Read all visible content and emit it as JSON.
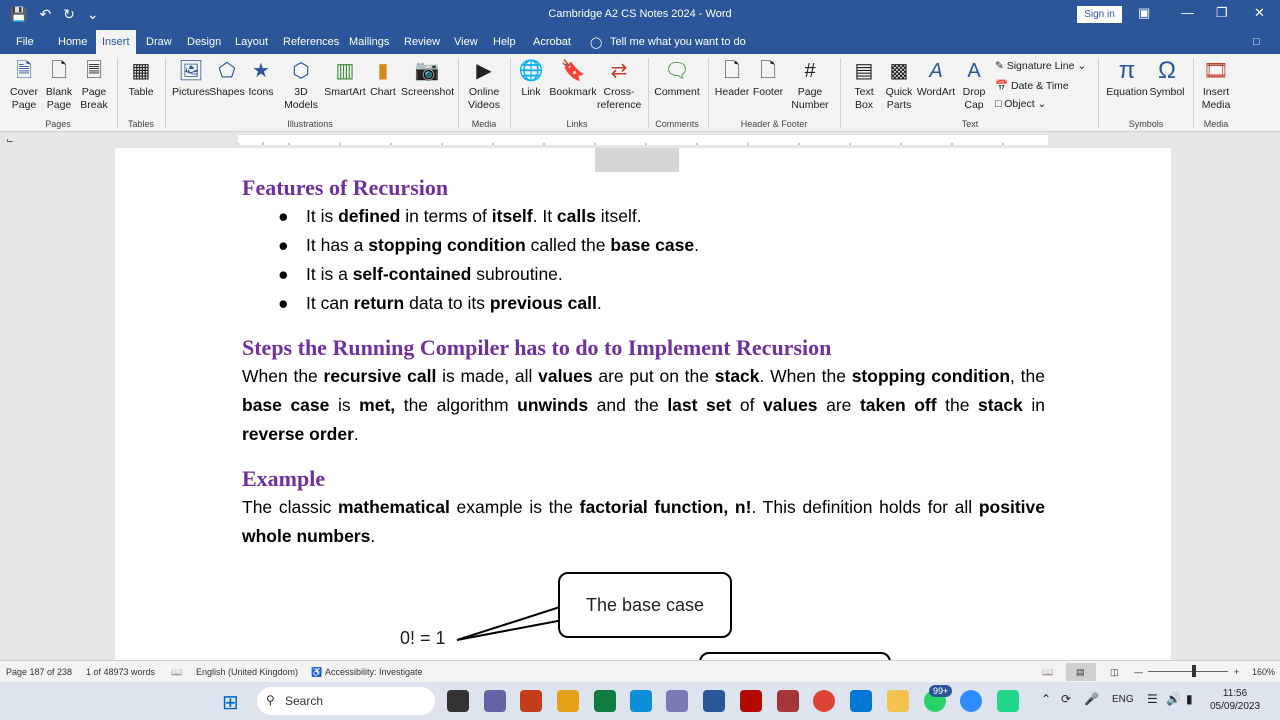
{
  "window": {
    "title": "Cambridge A2 CS Notes 2024  -  Word",
    "sign_in": "Sign in"
  },
  "tabs": [
    "File",
    "Home",
    "Insert",
    "Draw",
    "Design",
    "Layout",
    "References",
    "Mailings",
    "Review",
    "View",
    "Help",
    "Acrobat",
    "Tell me what you want to do"
  ],
  "ribbon": {
    "cover_page": "Cover Page",
    "blank_page": "Blank Page",
    "page_break": "Page Break",
    "group_pages": "Pages",
    "table": "Table",
    "group_tables": "Tables",
    "pictures": "Pictures",
    "shapes": "Shapes",
    "icons": "Icons",
    "models": "3D Models",
    "smartart": "SmartArt",
    "chart": "Chart",
    "screenshot": "Screenshot",
    "group_illustrations": "Illustrations",
    "online_videos": "Online Videos",
    "group_media": "Media",
    "link": "Link",
    "bookmark": "Bookmark",
    "crossref": "Cross-reference",
    "group_links": "Links",
    "comment": "Comment",
    "group_comments": "Comments",
    "header": "Header",
    "footer": "Footer",
    "page_number": "Page Number",
    "group_hf": "Header & Footer",
    "text_box": "Text Box",
    "quick_parts": "Quick Parts",
    "wordart": "WordArt",
    "drop_cap": "Drop Cap",
    "signature_line": "Signature Line",
    "date_time": "Date & Time",
    "object": "Object",
    "group_text": "Text",
    "equation": "Equation",
    "symbol": "Symbol",
    "group_symbols": "Symbols",
    "insert_media": "Insert Media",
    "group_media2": "Media"
  },
  "doc": {
    "features_heading": "Features of Recursion",
    "bullets": [
      {
        "a": "It is ",
        "b": "defined",
        "c": " in terms of ",
        "d": "itself",
        "e": ". It ",
        "f": "calls",
        "g": " itself."
      },
      {
        "a": "It has a ",
        "b": "stopping condition",
        "c": " called the ",
        "d": "base case",
        "e": ".",
        "f": "",
        "g": ""
      },
      {
        "a": "It is a ",
        "b": "self-contained",
        "c": " subroutine.",
        "d": "",
        "e": "",
        "f": "",
        "g": ""
      },
      {
        "a": "It can ",
        "b": "return",
        "c": " data to its ",
        "d": "previous call",
        "e": ".",
        "f": "",
        "g": ""
      }
    ],
    "steps_heading": "Steps the Running Compiler has to do to Implement Recursion",
    "steps": {
      "t1": "When the ",
      "b1": "recursive call",
      "t2": " is made, all ",
      "b2": "values",
      "t3": " are put on the ",
      "b3": "stack",
      "t4": ". When the ",
      "b4": "stopping condition",
      "t5": ", the ",
      "b5": "base case",
      "t6": " is ",
      "b6": "met,",
      "t7": " the algorithm ",
      "b7": "unwinds",
      "t8": " and the ",
      "b8": "last set",
      "t9": " of ",
      "b9": "values",
      "t10": " are ",
      "b10": "taken off",
      "t11": " the ",
      "b11": "stack",
      "t12": " in ",
      "b12": "reverse order",
      "t13": "."
    },
    "example_heading": "Example",
    "example": {
      "t1": "The classic ",
      "b1": "mathematical",
      "t2": " example is the ",
      "b2": "factorial function, n!",
      "t3": ". This definition holds for all ",
      "b3": "positive whole numbers",
      "t4": "."
    },
    "callout": "The base case",
    "formula": "0! = 1"
  },
  "status": {
    "page": "Page 187 of 238",
    "words": "1 of 48973 words",
    "language": "English (United Kingdom)",
    "accessibility": "Accessibility: Investigate",
    "zoom": "160%"
  },
  "taskbar": {
    "search": "Search",
    "badge": "99+",
    "lang": "ENG",
    "time": "11:56",
    "date": "05/09/2023"
  }
}
